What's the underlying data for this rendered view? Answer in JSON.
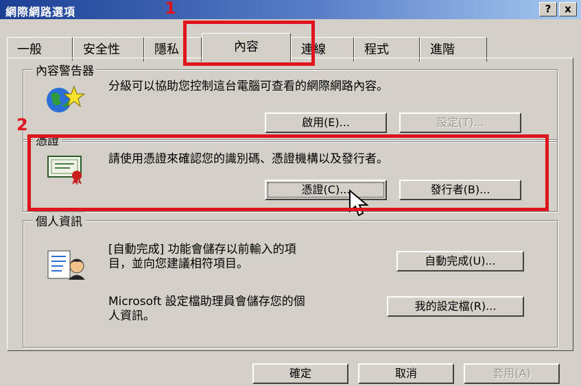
{
  "window": {
    "title": "網際網路選項",
    "help_label": "?",
    "close_label": "x"
  },
  "tabs": [
    {
      "label": "一般"
    },
    {
      "label": "安全性"
    },
    {
      "label": "隱私"
    },
    {
      "label": "內容"
    },
    {
      "label": "連線"
    },
    {
      "label": "程式"
    },
    {
      "label": "進階"
    }
  ],
  "content_advisor": {
    "legend": "內容警告器",
    "description": "分級可以協助您控制這台電腦可查看的網際網路內容。",
    "enable_label": "啟用(E)...",
    "settings_label": "設定(T)..."
  },
  "certificates": {
    "legend": "憑證",
    "description": "請使用憑證來確認您的識別碼、憑證機構以及發行者。",
    "certificates_label": "憑證(C)...",
    "publishers_label": "發行者(B)..."
  },
  "personal": {
    "legend": "個人資訊",
    "autocomplete_desc_1": "[自動完成] 功能會儲存以前輸入的項",
    "autocomplete_desc_2": "目，並向您建議相符項目。",
    "autocomplete_label": "自動完成(U)...",
    "profile_desc_1": "Microsoft 設定檔助理員會儲存您的個",
    "profile_desc_2": "人資訊。",
    "profile_label": "我的設定檔(R)..."
  },
  "footer": {
    "ok_label": "確定",
    "cancel_label": "取消",
    "apply_label": "套用(A)"
  },
  "annotations": {
    "step1": "1",
    "step2": "2",
    "color": "#e0141e"
  }
}
